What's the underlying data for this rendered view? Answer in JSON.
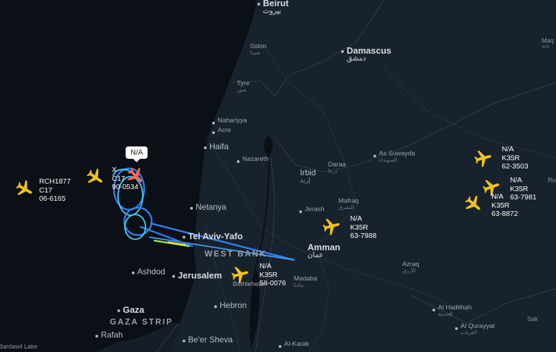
{
  "cities": [
    {
      "id": "beirut",
      "name": "Beirut",
      "arabic": "بيروت",
      "size": "major"
    },
    {
      "id": "sidon",
      "name": "Sidon",
      "arabic": "صيدا",
      "size": "small"
    },
    {
      "id": "tyre",
      "name": "Tyre",
      "arabic": "صور",
      "size": "small"
    },
    {
      "id": "damascus",
      "name": "Damascus",
      "arabic": "دمشق",
      "size": "major"
    },
    {
      "id": "nahariyya",
      "name": "Nahariyya",
      "size": "small"
    },
    {
      "id": "acre",
      "name": "Acre",
      "size": "small"
    },
    {
      "id": "haifa",
      "name": "Haifa",
      "size": "mid"
    },
    {
      "id": "nazareth",
      "name": "Nazareth",
      "size": "small"
    },
    {
      "id": "as-suwayda",
      "name": "As Suwayda",
      "arabic": "السويداء",
      "size": "small"
    },
    {
      "id": "irbid",
      "name": "Irbid",
      "arabic": "إربد",
      "size": "mid"
    },
    {
      "id": "daraa",
      "name": "Daraa",
      "arabic": "درعا",
      "size": "small"
    },
    {
      "id": "mafraq",
      "name": "Mafraq",
      "arabic": "المفرق",
      "size": "small"
    },
    {
      "id": "jerash",
      "name": "Jerash",
      "size": "small"
    },
    {
      "id": "netanya",
      "name": "Netanya",
      "size": "mid"
    },
    {
      "id": "tel-aviv",
      "name": "Tel Aviv-Yafo",
      "size": "major"
    },
    {
      "id": "amman",
      "name": "Amman",
      "arabic": "عمان",
      "size": "major"
    },
    {
      "id": "ashdod",
      "name": "Ashdod",
      "size": "mid"
    },
    {
      "id": "jerusalem",
      "name": "Jerusalem",
      "size": "major"
    },
    {
      "id": "bethlehem",
      "name": "Bethlehem",
      "size": "small"
    },
    {
      "id": "madaba",
      "name": "Madaba",
      "arabic": "مادبا",
      "size": "small"
    },
    {
      "id": "azraq",
      "name": "Azraq",
      "arabic": "الأزرق",
      "size": "small"
    },
    {
      "id": "hebron",
      "name": "Hebron",
      "size": "mid"
    },
    {
      "id": "gaza",
      "name": "Gaza",
      "size": "major"
    },
    {
      "id": "rafah",
      "name": "Rafah",
      "size": "mid"
    },
    {
      "id": "beer-sheva",
      "name": "Be'er Sheva",
      "size": "mid"
    },
    {
      "id": "al-karak",
      "name": "Al-Karak",
      "size": "small"
    },
    {
      "id": "al-hadithah",
      "name": "Al Hadithah",
      "arabic": "الحديثة",
      "size": "small"
    },
    {
      "id": "al-qurayyat",
      "name": "Al Qurayyat",
      "arabic": "القريات",
      "size": "small"
    },
    {
      "id": "sakakah-partial",
      "name": "Sak",
      "size": "tiny"
    },
    {
      "id": "maq-partial",
      "name": "Maq",
      "arabic": "ash",
      "size": "tiny"
    },
    {
      "id": "bardawil",
      "name": "Bardawil Lake",
      "size": "tiny"
    },
    {
      "id": "r-partial",
      "name": "Ru",
      "size": "tiny"
    }
  ],
  "regions": [
    {
      "id": "west-bank",
      "name": "WEST BANK"
    },
    {
      "id": "gaza-strip",
      "name": "GAZA STRIP"
    }
  ],
  "aircraft": [
    {
      "id": "rch1877",
      "callsign": "RCH1877",
      "type": "C17",
      "reg": "06-6165",
      "color": "#f2c21a",
      "heading": 120
    },
    {
      "id": "plane-unlabeled",
      "color": "#f2c21a",
      "heading": 125
    },
    {
      "id": "c17-selected",
      "mark": "X",
      "type": "C17",
      "reg": "90-0534",
      "color": "#f06a5a",
      "heading": 135,
      "callout": "N/A"
    },
    {
      "id": "k35r-62-3503",
      "callsign": "N/A",
      "type": "K35R",
      "reg": "62-3503",
      "color": "#f2c21a",
      "heading": 75
    },
    {
      "id": "k35r-63-7981",
      "callsign": "N/A",
      "type": "K35R",
      "reg": "63-7981",
      "color": "#f2c21a",
      "heading": 70
    },
    {
      "id": "k35r-63-8872",
      "callsign": "N/A",
      "type": "K35R",
      "reg": "63-8872",
      "color": "#f2c21a",
      "heading": 130
    },
    {
      "id": "k35r-63-7988",
      "callsign": "N/A",
      "type": "K35R",
      "reg": "63-7988",
      "color": "#f2c21a",
      "heading": 75
    },
    {
      "id": "k35r-58-0076",
      "callsign": "N/A",
      "type": "K35R",
      "reg": "58-0076",
      "color": "#f2c21a",
      "heading": 75
    }
  ],
  "colors": {
    "sea": "#0b0f16",
    "land": "#18222d",
    "track": "#2f7fe8",
    "track_light": "#46c6ef",
    "plane": "#f2c21a",
    "selected_plane": "#f06a5a"
  }
}
